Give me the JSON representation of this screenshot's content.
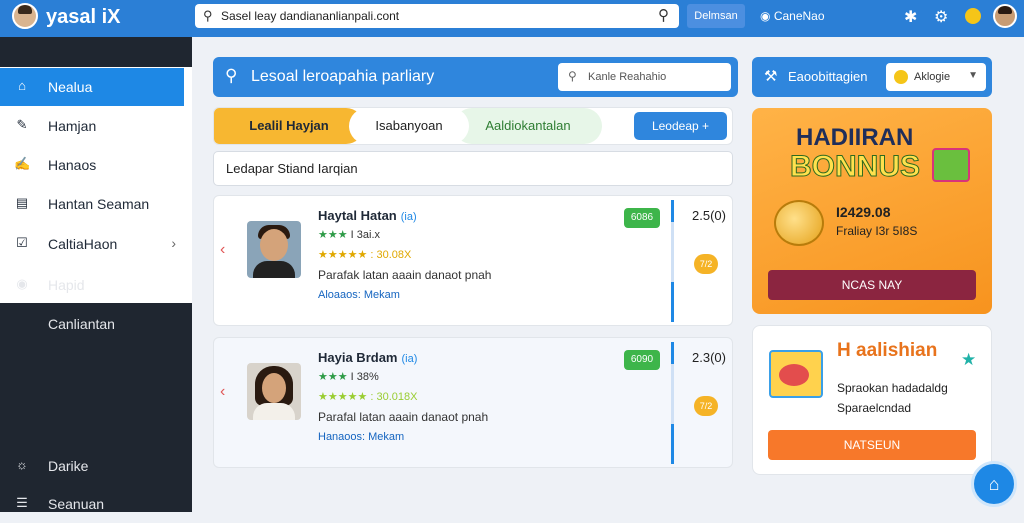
{
  "topbar": {
    "brand": "yasal iX",
    "search_value": "Sasel leay dandiananlianpali.cont",
    "button_label": "Delmsan",
    "link_label": "CaneNao"
  },
  "sidebar": {
    "items": [
      {
        "label": "Nealua",
        "icon": "home-icon"
      },
      {
        "label": "Hamjan",
        "icon": "edit-icon"
      },
      {
        "label": "Hanaos",
        "icon": "pencil-icon"
      },
      {
        "label": "Hantan Seaman",
        "icon": "folder-icon"
      },
      {
        "label": "CaltiaHaon",
        "icon": "checkbox-icon"
      },
      {
        "label": "Hapid",
        "icon": "globe-icon"
      },
      {
        "label": "Canliantan",
        "icon": ""
      },
      {
        "label": "Darike",
        "icon": "bulb-icon"
      },
      {
        "label": "Seanuan",
        "icon": "list-icon"
      }
    ]
  },
  "main": {
    "header_title": "Lesoal leroapahia parliary",
    "header_search_placeholder": "Kanle Reahahio",
    "tabs": [
      "Lealil Hayjan",
      "Isabanyoan",
      "Aaldiokantalan"
    ],
    "tab_button": "Leodeap",
    "sub_input": "Ledapar Stiand Iarqian",
    "cards": [
      {
        "name": "Haytal Hatan",
        "tag": "(ia)",
        "rating_a": "I 3ai.x",
        "rating_b": "30.08X",
        "description": "Parafak latan aaain danaot pnah",
        "meta": "Aloaaos: Mekam",
        "badge": "6086",
        "price": "2.5(0)",
        "coin": "7/2"
      },
      {
        "name": "Hayia Brdam",
        "tag": "(ia)",
        "rating_a": "I 38%",
        "rating_b": "30.018X",
        "description": "Parafal latan aaain danaot pnah",
        "meta": "Hanaoos: Mekam",
        "badge": "6090",
        "price": "2.3(0)",
        "coin": "7/2"
      }
    ]
  },
  "right": {
    "header_title": "Eaoobittagien",
    "select_value": "Aklogie",
    "bonus": {
      "title_line1": "HADIIRAN",
      "title_line2": "BONNUS",
      "amount": "I2429.08",
      "amount_sub": "Fraliay I3r 5I8S",
      "button": "NCAS NAY"
    },
    "promo": {
      "title": "H aalishian",
      "desc_line1": "Spraokan hadadaldg",
      "desc_line2": "Sparaelcndad",
      "button": "NATSEUN"
    }
  }
}
